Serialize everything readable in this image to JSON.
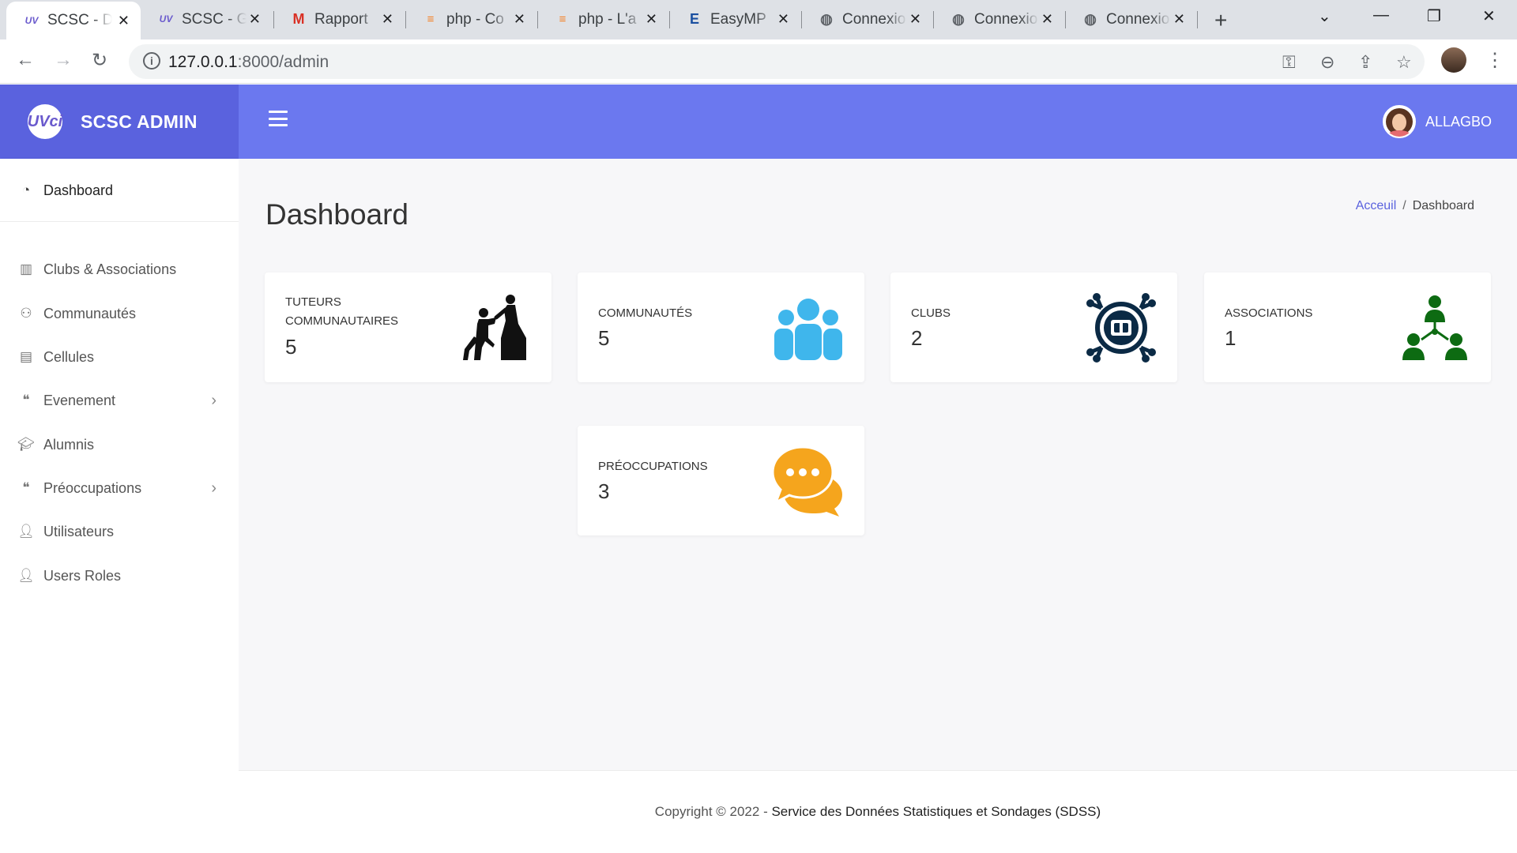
{
  "browser": {
    "tabs": [
      {
        "title": "SCSC - D",
        "favicon": "uvci-logo-icon",
        "active": true
      },
      {
        "title": "SCSC - G",
        "favicon": "uvci-logo-icon",
        "active": false
      },
      {
        "title": "Rapport",
        "favicon": "gmail-icon",
        "active": false
      },
      {
        "title": "php - Co",
        "favicon": "stackoverflow-icon",
        "active": false
      },
      {
        "title": "php - L'a",
        "favicon": "stackoverflow-icon",
        "active": false
      },
      {
        "title": "EasyMP",
        "favicon": "easymp-icon",
        "active": false
      },
      {
        "title": "Connexio",
        "favicon": "globe-icon",
        "active": false
      },
      {
        "title": "Connexio",
        "favicon": "globe-icon",
        "active": false
      },
      {
        "title": "Connexio",
        "favicon": "globe-icon",
        "active": false
      }
    ],
    "url_host": "127.0.0.1",
    "url_rest": ":8000/admin"
  },
  "brand": {
    "logo_text": "UVci",
    "name": "SCSC ADMIN"
  },
  "topbar": {
    "user_name": "ALLAGBO"
  },
  "sidebar": {
    "items": [
      {
        "label": "Dashboard",
        "icon": "dashboard-gauge-icon",
        "active": true,
        "has_children": false
      },
      {
        "label": "Clubs & Associations",
        "icon": "institution-icon",
        "active": false,
        "has_children": false
      },
      {
        "label": "Communautés",
        "icon": "users-group-icon",
        "active": false,
        "has_children": false
      },
      {
        "label": "Cellules",
        "icon": "list-alt-icon",
        "active": false,
        "has_children": false
      },
      {
        "label": "Evenement",
        "icon": "comments-icon",
        "active": false,
        "has_children": true
      },
      {
        "label": "Alumnis",
        "icon": "graduation-cap-icon",
        "active": false,
        "has_children": false
      },
      {
        "label": "Préoccupations",
        "icon": "comments-icon",
        "active": false,
        "has_children": true
      },
      {
        "label": "Utilisateurs",
        "icon": "user-icon",
        "active": false,
        "has_children": false
      },
      {
        "label": "Users Roles",
        "icon": "user-icon",
        "active": false,
        "has_children": false
      }
    ]
  },
  "page": {
    "title": "Dashboard",
    "breadcrumb": {
      "home": "Acceuil",
      "separator": "/",
      "current": "Dashboard"
    }
  },
  "cards": [
    {
      "label": "TUTEURS COMMUNAUTAIRES",
      "value": "5",
      "icon": "tutor-helping-hand-icon",
      "color": "#111111"
    },
    {
      "label": "COMMUNAUTÉS",
      "value": "5",
      "icon": "people-group-icon",
      "color": "#3fb6ec"
    },
    {
      "label": "CLUBS",
      "value": "2",
      "icon": "club-network-icon",
      "color": "#0b2a45"
    },
    {
      "label": "ASSOCIATIONS",
      "value": "1",
      "icon": "org-hierarchy-icon",
      "color": "#0d6b12"
    },
    {
      "label": "PRÉOCCUPATIONS",
      "value": "3",
      "icon": "chat-bubbles-icon",
      "color": "#f5a51d"
    }
  ],
  "footer": {
    "prefix": "Copyright © 2022 - ",
    "org": "Service des Données Statistiques et Sondages (SDSS)"
  },
  "colors": {
    "brand_bg": "#5a62de",
    "topbar_bg": "#6b78ef",
    "accent_link": "#5a62de"
  }
}
